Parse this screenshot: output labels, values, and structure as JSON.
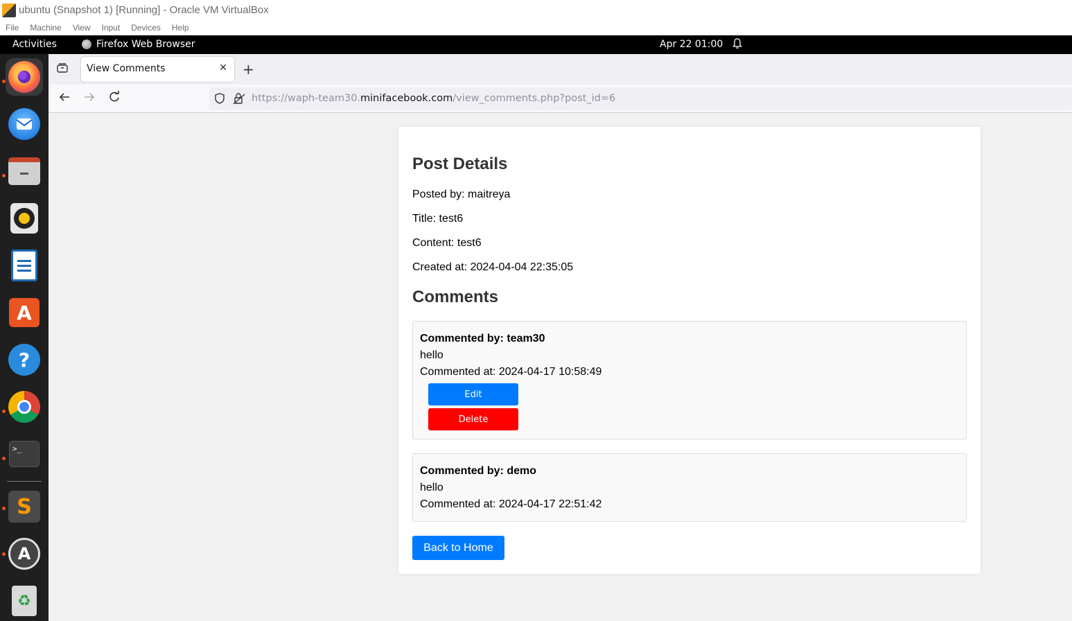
{
  "window": {
    "title": "ubuntu (Snapshot 1) [Running] - Oracle VM VirtualBox",
    "menu": [
      "File",
      "Machine",
      "View",
      "Input",
      "Devices",
      "Help"
    ]
  },
  "topbar": {
    "activities": "Activities",
    "app_name": "Firefox Web Browser",
    "clock": "Apr 22  01:00"
  },
  "dock": {
    "items": [
      "firefox",
      "thunderbird",
      "files",
      "rhythmbox",
      "libreoffice-writer",
      "app-center",
      "help",
      "chrome",
      "terminal",
      "sublime-text",
      "software-updater",
      "trash"
    ]
  },
  "browser": {
    "tab_title": "View Comments",
    "url_prefix": "https://waph-team30.",
    "url_domain": "minifacebook.com",
    "url_path": "/view_comments.php?post_id=6"
  },
  "post": {
    "heading": "Post Details",
    "posted_by": "Posted by: maitreya",
    "title": "Title: test6",
    "content": "Content: test6",
    "created_at": "Created at: 2024-04-04 22:35:05"
  },
  "comments": {
    "heading": "Comments",
    "items": [
      {
        "author": "Commented by: team30",
        "text": "hello",
        "time": "Commented at: 2024-04-17 10:58:49",
        "edit_label": "Edit",
        "delete_label": "Delete"
      },
      {
        "author": "Commented by: demo",
        "text": "hello",
        "time": "Commented at: 2024-04-17 22:51:42"
      }
    ]
  },
  "back_home_label": "Back to Home",
  "colors": {
    "primary": "#007bff",
    "danger": "#ff0000",
    "ubuntu_orange": "#e95420"
  }
}
